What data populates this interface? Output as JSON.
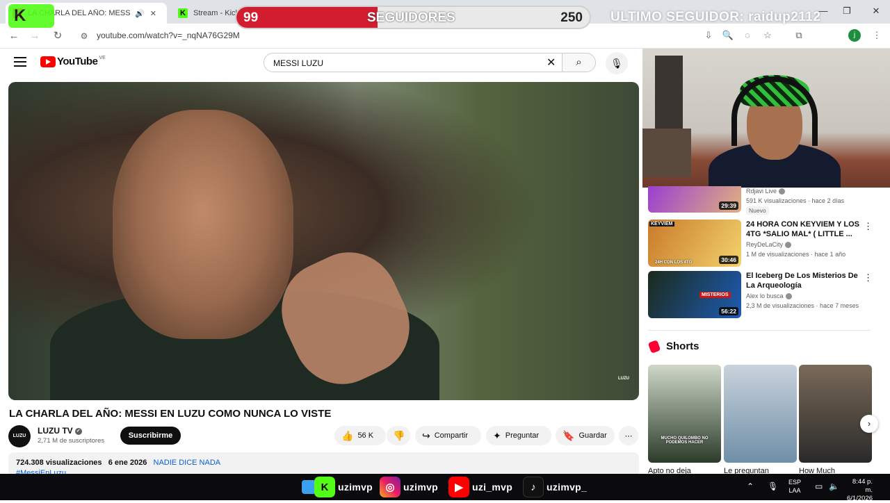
{
  "browser": {
    "tabs": [
      {
        "title": "LA CHARLA DEL AÑO: MESSI",
        "active": true
      },
      {
        "title": "Stream - Kick",
        "active": false
      }
    ],
    "new_tab": "+",
    "url": "youtube.com/watch?v=_nqNA76G29M",
    "window": {
      "minimize": "—",
      "restore": "❐",
      "close": "✕"
    }
  },
  "overlay": {
    "kick_logo_text": "K",
    "followers_current": "99",
    "followers_label": "SEGUIDORES",
    "followers_goal": "250",
    "followers_progress": 0.4,
    "last_follower": "ULTIMO SEGUIDOR: raidup2112"
  },
  "youtube": {
    "logo_text": "YouTube",
    "country_code": "VE",
    "search": {
      "query": "MESSI LUZU"
    },
    "video": {
      "title": "LA CHARLA DEL AÑO: MESSI EN LUZU COMO NUNCA LO VISTE",
      "watermark": "LUZU",
      "channel": {
        "name": "LUZU TV",
        "subscribers": "2,71 M de suscriptores",
        "avatar_text": "LUZU"
      },
      "subscribe_label": "Suscribirme",
      "likes": "56 K",
      "share_label": "Compartir",
      "ask_label": "Preguntar",
      "save_label": "Guardar",
      "views": "724.308 visualizaciones",
      "date": "6 ene 2026",
      "tag_inline": "NADIE DICE NADA",
      "hashtag": "#MessiEnLuzu"
    },
    "recommendations": [
      {
        "title": "",
        "channel": "Rdjavi Live",
        "meta": "591 K visualizaciones · hace 2 días",
        "badge": "Nuevo",
        "duration": "29:39",
        "thumb_colors": [
          "#9a3fd0",
          "#e0b080"
        ]
      },
      {
        "title": "24 HORA CON KEYVIEM Y LOS 4TG *SALIO MAL* ( LITTLE ...",
        "channel": "ReyDeLaCity",
        "meta": "1 M de visualizaciones · hace 1 año",
        "duration": "30:46",
        "thumb_text": "KEYVIEM",
        "thumb_bottom": "24H CON LOS 4TG",
        "thumb_colors": [
          "#c97a2a",
          "#f2d26b"
        ]
      },
      {
        "title": "El Iceberg De Los Misterios De La Arqueología",
        "channel": "Alex lo busca",
        "meta": "2,3 M de visualizaciones · hace 7 meses",
        "duration": "56:22",
        "thumb_text": "MISTERIOS",
        "thumb_colors": [
          "#1b2a1a",
          "#1e5bb5"
        ]
      }
    ],
    "shorts": {
      "heading": "Shorts",
      "items": [
        {
          "label": "Apto no deja",
          "caption": "MUCHO QUILOMBO NO PODEMOS HACER",
          "colors": [
            "#2b3b2a",
            "#cfd8c8"
          ]
        },
        {
          "label": "Le preguntan",
          "caption": "",
          "colors": [
            "#6f8fa8",
            "#c9d3dc"
          ]
        },
        {
          "label": "How Much",
          "caption": "",
          "colors": [
            "#2a2a2a",
            "#7a6a58"
          ]
        }
      ]
    }
  },
  "taskbar": {
    "handles": [
      "uzimvp",
      "uzimvp",
      "uzi_mvp",
      "uzimvp_"
    ],
    "lang_top": "ESP",
    "lang_bottom": "LAA",
    "time": "8:44 p. m.",
    "date": "6/1/2026"
  },
  "colors": {
    "kick_green": "#53fc18",
    "follow_red": "#d11d2f",
    "yt_red": "#ff0000",
    "link_blue": "#065fd4"
  }
}
